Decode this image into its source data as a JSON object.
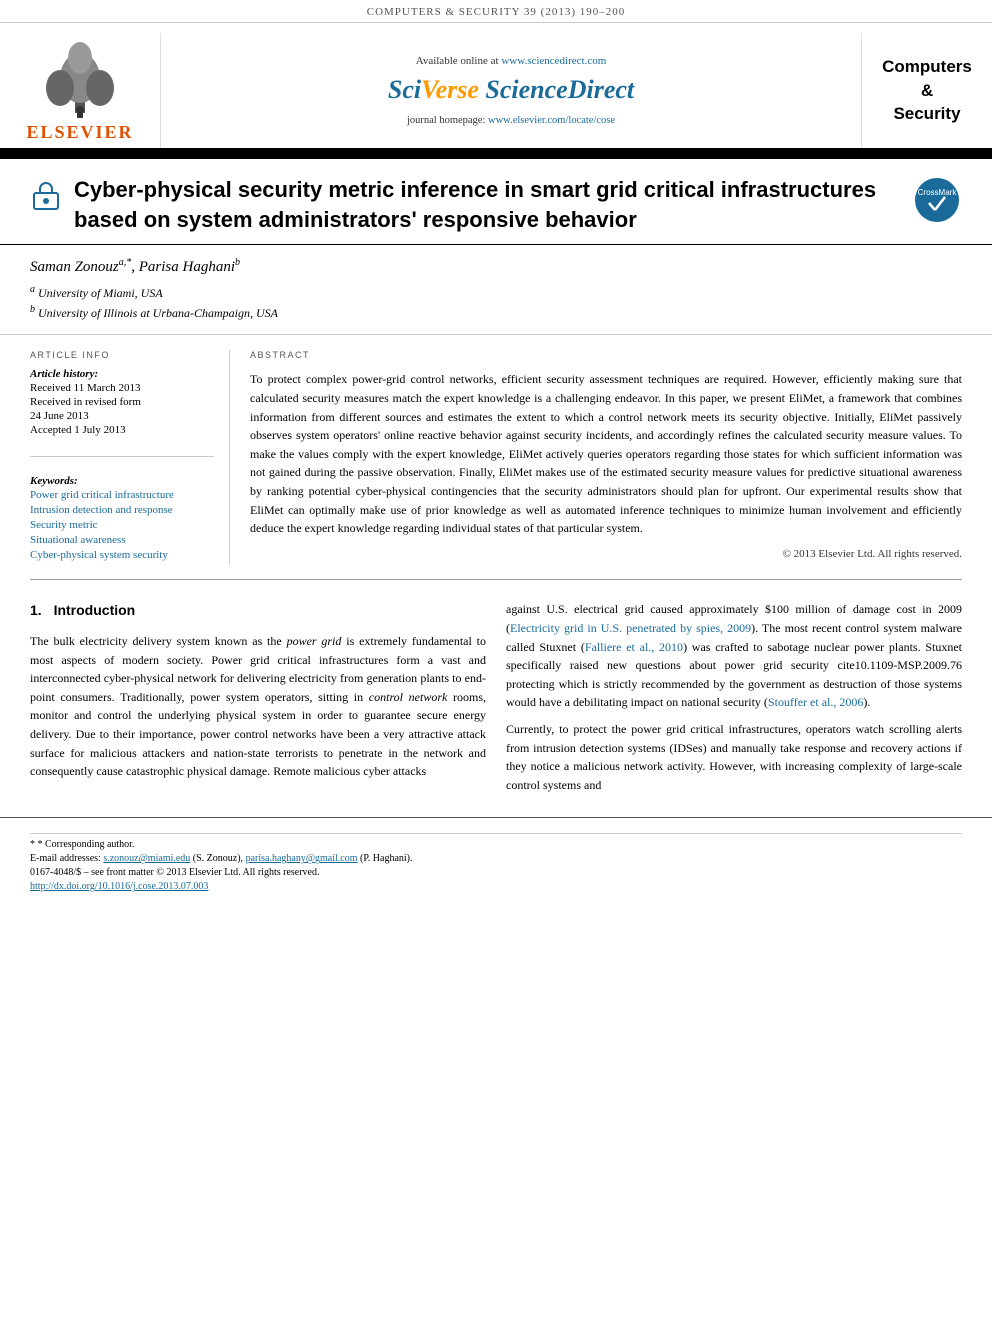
{
  "topbar": {
    "journal_ref": "COMPUTERS & SECURITY 39 (2013) 190–200"
  },
  "header": {
    "available_online": "Available online at",
    "sciverse_url": "www.sciencedirect.com",
    "sciverse_logo": "SciVerse ScienceDirect",
    "journal_homepage_label": "journal homepage:",
    "journal_homepage_url": "www.elsevier.com/locate/cose",
    "elsevier_text": "ELSEVIER",
    "computers_security_title": "Computers\n&\nSecurity"
  },
  "article": {
    "title": "Cyber-physical security metric inference in smart grid critical infrastructures based on system administrators' responsive behavior",
    "authors": "Saman Zonouz a,*, Parisa Haghani b",
    "affiliations": [
      {
        "id": "a",
        "text": "University of Miami, USA"
      },
      {
        "id": "b",
        "text": "University of Illinois at Urbana-Champaign, USA"
      }
    ]
  },
  "article_info": {
    "section_title": "ARTICLE INFO",
    "history_label": "Article history:",
    "received_1": "Received 11 March 2013",
    "received_revised": "Received in revised form",
    "received_revised_date": "24 June 2013",
    "accepted": "Accepted 1 July 2013",
    "keywords_label": "Keywords:",
    "keywords": [
      "Power grid critical infrastructure",
      "Intrusion detection and response",
      "Security metric",
      "Situational awareness",
      "Cyber-physical system security"
    ]
  },
  "abstract": {
    "section_title": "ABSTRACT",
    "text": "To protect complex power-grid control networks, efficient security assessment techniques are required. However, efficiently making sure that calculated security measures match the expert knowledge is a challenging endeavor. In this paper, we present EliMet, a framework that combines information from different sources and estimates the extent to which a control network meets its security objective. Initially, EliMet passively observes system operators' online reactive behavior against security incidents, and accordingly refines the calculated security measure values. To make the values comply with the expert knowledge, EliMet actively queries operators regarding those states for which sufficient information was not gained during the passive observation. Finally, EliMet makes use of the estimated security measure values for predictive situational awareness by ranking potential cyber-physical contingencies that the security administrators should plan for upfront. Our experimental results show that EliMet can optimally make use of prior knowledge as well as automated inference techniques to minimize human involvement and efficiently deduce the expert knowledge regarding individual states of that particular system.",
    "copyright": "© 2013 Elsevier Ltd. All rights reserved."
  },
  "introduction": {
    "section_num": "1.",
    "section_title": "Introduction",
    "col_left_paragraphs": [
      "The bulk electricity delivery system known as the power grid is extremely fundamental to most aspects of modern society. Power grid critical infrastructures form a vast and interconnected cyber-physical network for delivering electricity from generation plants to end-point consumers. Traditionally, power system operators, sitting in control network rooms, monitor and control the underlying physical system in order to guarantee secure energy delivery. Due to their importance, power control networks have been a very attractive attack surface for malicious attackers and nation-state terrorists to penetrate in the network and consequently cause catastrophic physical damage. Remote malicious cyber attacks",
      "against U.S. electrical grid caused approximately $100 million of damage cost in 2009 (Electricity grid in U.S. penetrated by spies, 2009). The most recent control system malware called Stuxnet (Falliere et al., 2010) was crafted to sabotage nuclear power plants. Stuxnet specifically raised new questions about power grid security cite10.1109-MSP.2009.76 protecting which is strictly recommended by the government as destruction of those systems would have a debilitating impact on national security (Stouffer et al., 2006).",
      "Currently, to protect the power grid critical infrastructures, operators watch scrolling alerts from intrusion detection systems (IDSes) and manually take response and recovery actions if they notice a malicious network activity. However, with increasing complexity of large-scale control systems and"
    ]
  },
  "footer": {
    "corresponding_author_label": "* Corresponding author.",
    "email_line": "E-mail addresses: s.zonouz@miami.edu (S. Zonouz), parisa.haghany@gmail.com (P. Haghani).",
    "issn_line": "0167-4048/$ – see front matter © 2013 Elsevier Ltd. All rights reserved.",
    "doi_line": "http://dx.doi.org/10.1016/j.cose.2013.07.003"
  }
}
